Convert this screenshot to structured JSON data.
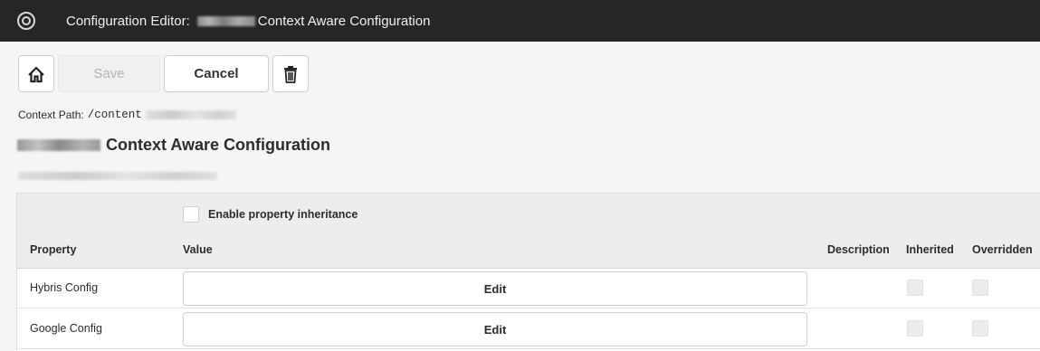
{
  "titlebar": {
    "prefix": "Configuration Editor:",
    "suffix": "Context Aware Configuration"
  },
  "toolbar": {
    "save_label": "Save",
    "cancel_label": "Cancel"
  },
  "context": {
    "label": "Context Path:",
    "path": "/content"
  },
  "heading": {
    "title": "Context Aware Configuration"
  },
  "table": {
    "inherit_label": "Enable property inheritance",
    "columns": {
      "property": "Property",
      "value": "Value",
      "description": "Description",
      "inherited": "Inherited",
      "overridden": "Overridden"
    },
    "rows": [
      {
        "property": "Hybris Config",
        "value": "Edit"
      },
      {
        "property": "Google Config",
        "value": "Edit"
      }
    ]
  }
}
